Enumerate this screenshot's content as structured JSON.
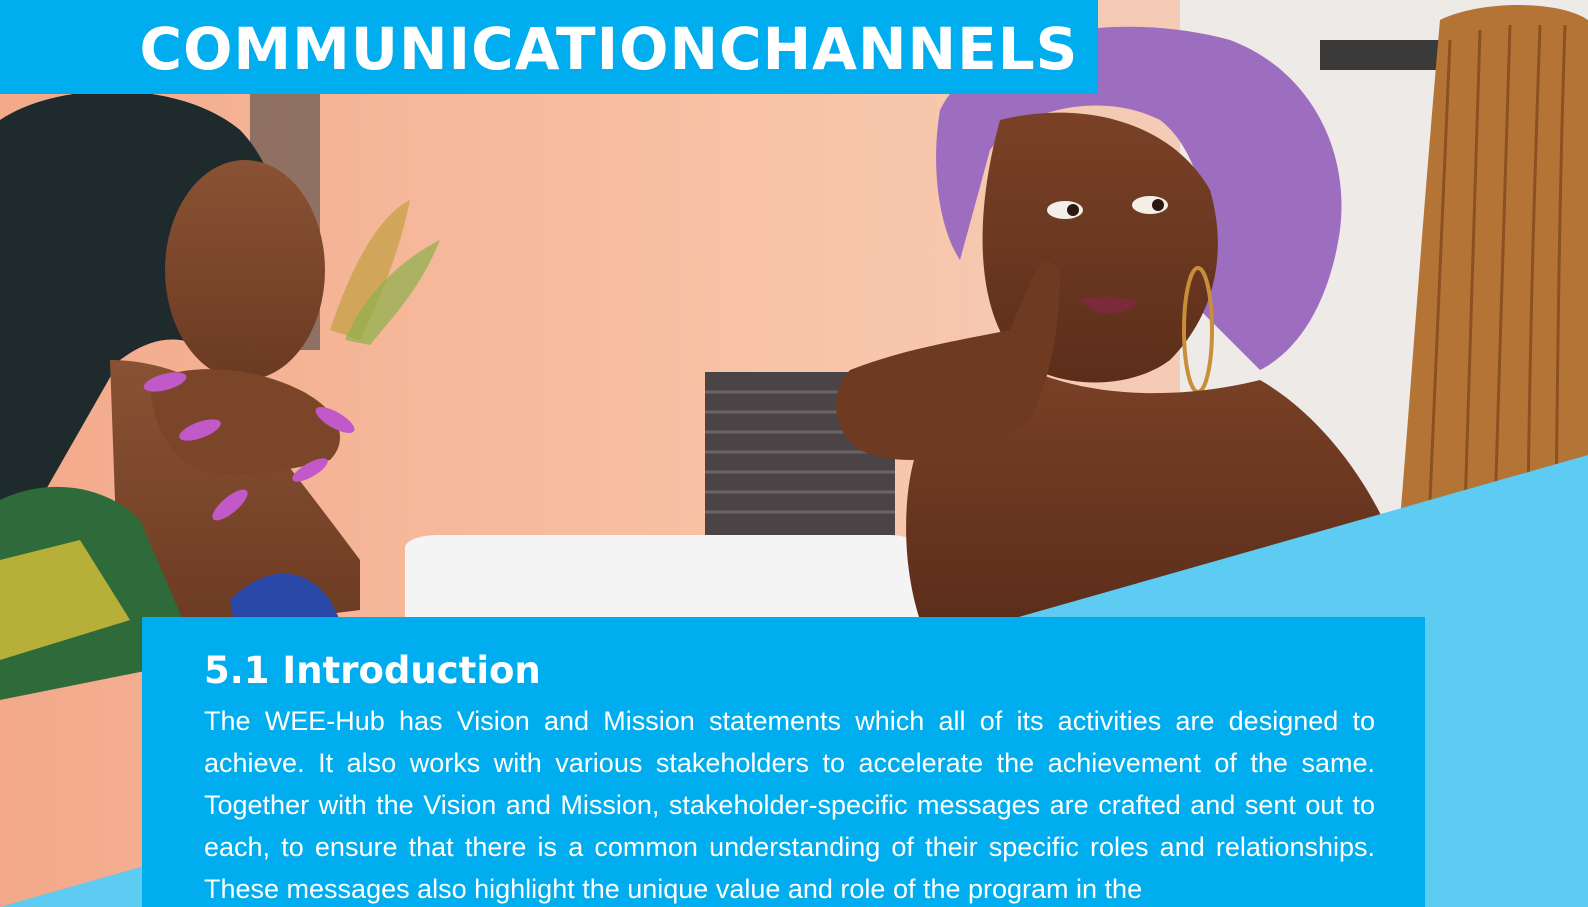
{
  "page": {
    "title": "COMMUNICATIONCHANNELS"
  },
  "section": {
    "heading": "5.1 Introduction",
    "body": "The WEE-Hub has Vision and Mission statements which all of its activities are designed to achieve. It also works with various stakeholders to accelerate the achievement of the same. Together with the Vision and Mission, stakeholder-specific messages are crafted and sent out to each, to ensure that there is a common understanding of their specific roles and relationships. These messages also highlight the unique value and role of the program in the"
  },
  "colors": {
    "accent": "#00aeef",
    "accent_light": "#5ecbf3",
    "text_on_accent": "#ffffff"
  },
  "icons": []
}
